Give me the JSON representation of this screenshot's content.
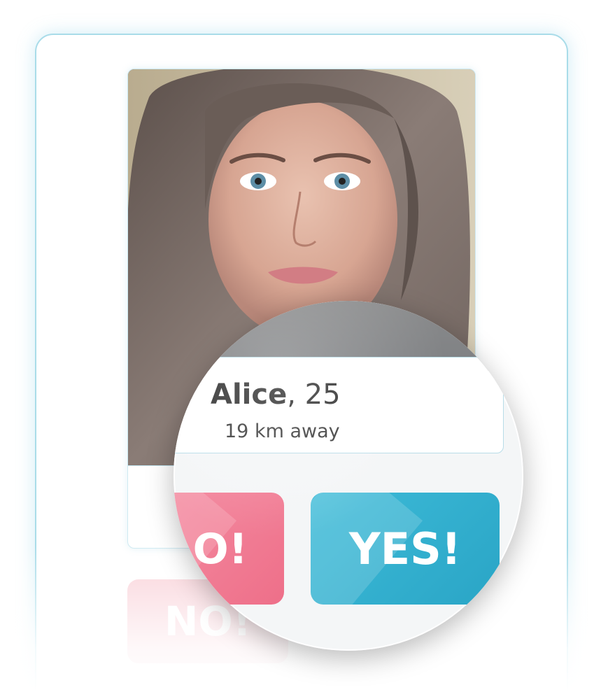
{
  "profile": {
    "name": "Alice",
    "age_separator": ", ",
    "age": "25",
    "distance": "19 km away"
  },
  "buttons": {
    "no_label": "NO!",
    "no_label_visible": "O!",
    "yes_label": "YES!",
    "ghost_no_label": "NO!"
  },
  "colors": {
    "accent_blue": "#2aa5c6",
    "accent_pink": "#ee6f89",
    "frame_border": "#a9dce9"
  },
  "icons": {
    "photo": "profile-photo"
  }
}
